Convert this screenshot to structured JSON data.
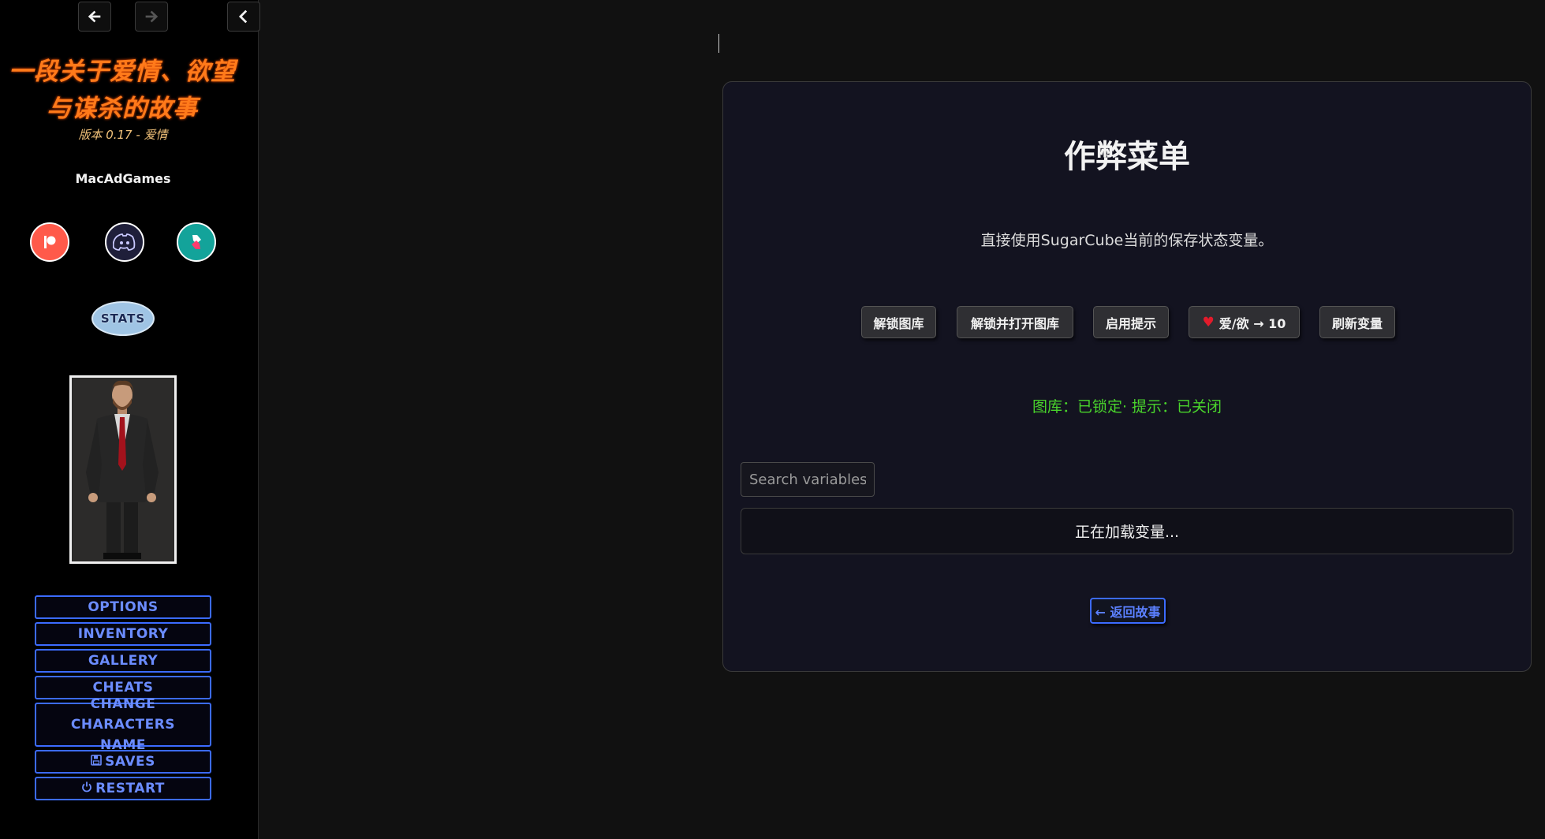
{
  "sidebar": {
    "history": {
      "back_icon": "arrow-left-icon",
      "forward_icon": "arrow-right-icon",
      "toggle_icon": "chevron-left-icon"
    },
    "title": "一段关于爱情、欲望与谋杀的故事",
    "subtitle": "版本 0.17 - 爱情",
    "author": "MacAdGames",
    "social_icons": [
      "patreon-icon",
      "discord-icon",
      "subscribestar-icon"
    ],
    "stats_label": "STATS",
    "menu": {
      "options": "OPTIONS",
      "inventory": "INVENTORY",
      "gallery": "GALLERY",
      "cheats": "CHEATS",
      "change_name": "CHANGE CHARACTERS NAME",
      "saves": "SAVES",
      "restart": "RESTART"
    }
  },
  "panel": {
    "title": "作弊菜单",
    "description": "直接使用SugarCube当前的保存状态变量。",
    "buttons": {
      "unlock_gallery": "解锁图库",
      "unlock_open_gallery": "解锁并打开图库",
      "enable_hints": "启用提示",
      "love_lust": "爱/欲 → 10",
      "refresh_vars": "刷新变量"
    },
    "status": "图库：已锁定· 提示：已关闭",
    "search_placeholder": "Search variables:",
    "loading_text": "正在加载变量...",
    "back_label": "← 返回故事"
  },
  "colors": {
    "title_orange": "#ff7a1a",
    "menu_blue": "#3c6bff",
    "status_green": "#49d42b",
    "heart_red": "#e21b2b"
  }
}
